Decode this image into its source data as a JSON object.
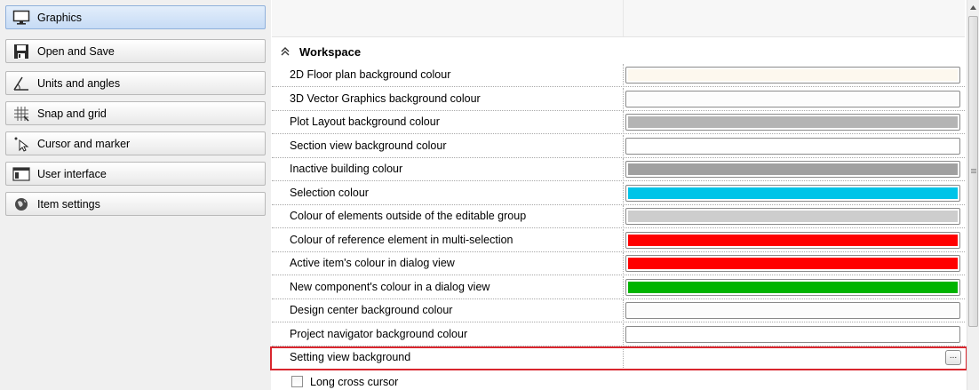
{
  "nav": {
    "items": [
      {
        "label": "Graphics",
        "icon": "monitor-icon",
        "selected": true
      },
      {
        "label": "Open and Save",
        "icon": "floppy-disk-icon",
        "selected": false
      },
      {
        "label": "Units and angles",
        "icon": "angle-icon",
        "selected": false
      },
      {
        "label": "Snap and grid",
        "icon": "grid-icon",
        "selected": false
      },
      {
        "label": "Cursor and marker",
        "icon": "cursor-icon",
        "selected": false
      },
      {
        "label": "User interface",
        "icon": "window-icon",
        "selected": false
      },
      {
        "label": "Item settings",
        "icon": "globe-icon",
        "selected": false
      }
    ]
  },
  "grid": {
    "category": {
      "title": "Workspace",
      "expanded": true
    },
    "rows": [
      {
        "label": "2D Floor plan background colour",
        "color": "#fdf8ee"
      },
      {
        "label": "3D Vector Graphics background colour",
        "color": "#fcfcfc"
      },
      {
        "label": "Plot Layout background colour",
        "color": "#b4b4b4"
      },
      {
        "label": "Section view background colour",
        "color": "#ffffff"
      },
      {
        "label": "Inactive building colour",
        "color": "#a0a0a0"
      },
      {
        "label": "Selection colour",
        "color": "#00c4e8"
      },
      {
        "label": "Colour of elements outside of the editable group",
        "color": "#cdcdcd"
      },
      {
        "label": "Colour of reference element in multi-selection",
        "color": "#ff0000"
      },
      {
        "label": "Active item's colour in dialog view",
        "color": "#ff0000"
      },
      {
        "label": "New component's colour in a dialog view",
        "color": "#00b400"
      },
      {
        "label": "Design center background colour",
        "color": "#fcfcfc"
      },
      {
        "label": "Project navigator background colour",
        "color": "#ffffff"
      }
    ],
    "setting_row": {
      "label": "Setting view background",
      "button": "..."
    },
    "checkbox": {
      "label": "Long cross cursor",
      "checked": false
    }
  },
  "colors": {
    "highlight": "#d9262e",
    "selected_nav": "#c6dbf5"
  }
}
